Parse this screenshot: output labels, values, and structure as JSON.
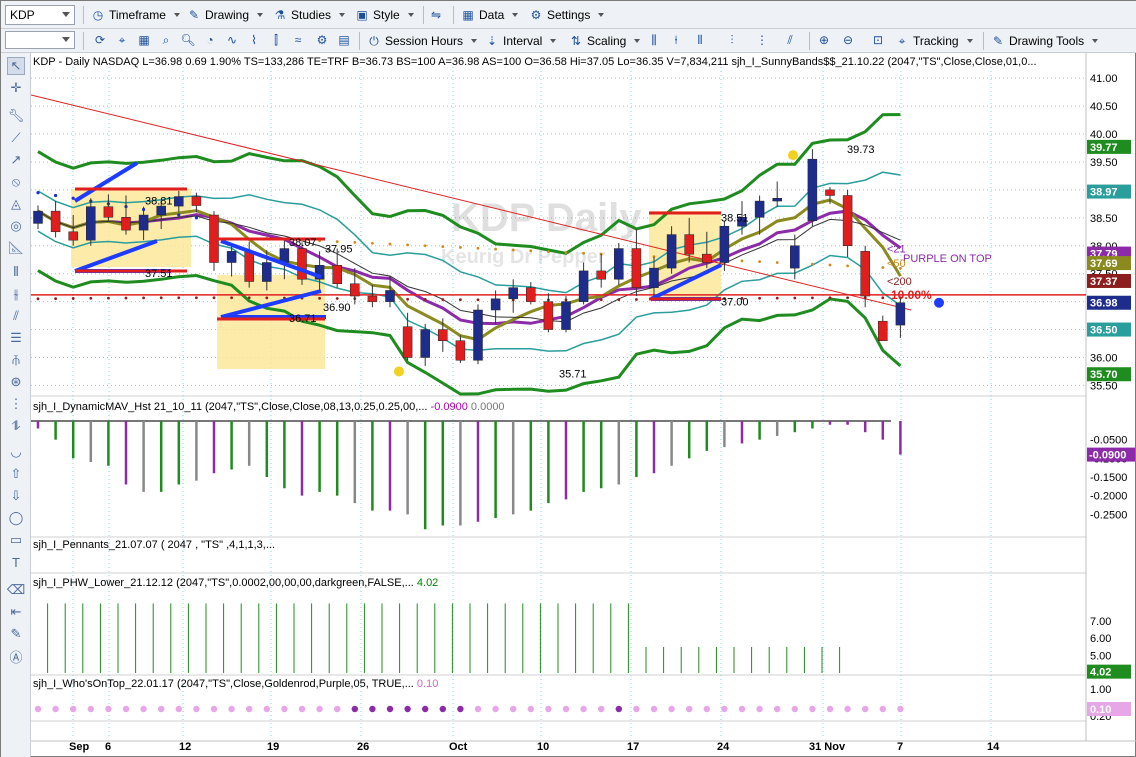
{
  "toolbar": {
    "symbol": "KDP",
    "timeframe": "Timeframe",
    "drawing": "Drawing",
    "studies": "Studies",
    "style": "Style",
    "data": "Data",
    "settings": "Settings",
    "session_hours": "Session Hours",
    "interval": "Interval",
    "scaling": "Scaling",
    "tracking": "Tracking",
    "drawing_tools": "Drawing Tools"
  },
  "header": {
    "line": "KDP - Daily  NASDAQ  L=36.98  0.69  1.90%  TS=133,286  TE=TRF  B=36.73  BS=100  A=36.98  AS=100  O=36.58  Hi=37.05  Lo=36.35  V=7,834,211  sjh_I_SunnyBands$$_21.10.22 (2047,\"TS\",Close,Close,01,0..."
  },
  "watermark": {
    "title": "KDP Daily",
    "subtitle": "Keurig Dr Pepper"
  },
  "price_labels": {
    "p3881": "38.81",
    "p3751": "37.51",
    "p3807": "38.07",
    "p3795": "37.95",
    "p3671": "36.71",
    "p3690": "36.90",
    "p3571": "35.71",
    "p3851": "38.51",
    "p3700": "37.00",
    "p3973": "39.73",
    "pct": "10.00%",
    "purple": "PURPLE ON TOP",
    "l21": "<21",
    "l50": "<50",
    "l200": "<200"
  },
  "axis": {
    "price_ticks": [
      "41.00",
      "40.50",
      "40.00",
      "39.50",
      "39.00",
      "38.50",
      "38.00",
      "37.50",
      "37.00",
      "36.50",
      "36.00",
      "35.50"
    ],
    "badges": [
      {
        "v": "39.77",
        "bg": "#1e8c1e",
        "fg": "#ffffff"
      },
      {
        "v": "38.97",
        "bg": "#2a9d9d",
        "fg": "#ffffff"
      },
      {
        "v": "37.79",
        "bg": "#8c2aa8",
        "fg": "#ffffff"
      },
      {
        "v": "37.69",
        "bg": "#8a8a1e",
        "fg": "#ffffff"
      },
      {
        "v": "37.37",
        "bg": "#8c1e1e",
        "fg": "#ffffff"
      },
      {
        "v": "36.98",
        "bg": "#1e2d8c",
        "fg": "#ffffff"
      },
      {
        "v": "36.50",
        "bg": "#2a9d9d",
        "fg": "#ffffff"
      },
      {
        "v": "35.70",
        "bg": "#1e8c1e",
        "fg": "#ffffff"
      }
    ],
    "dates": [
      "Sep",
      "6",
      "12",
      "19",
      "26",
      "Oct",
      "10",
      "17",
      "24",
      "31 Nov",
      "7",
      "14"
    ]
  },
  "panels": {
    "mav": {
      "label": "sjh_I_DynamicMAV_Hst 21_10_11 (2047,\"TS\",Close,Close,08,13,0.25,0.25,00,...",
      "v1": "-0.0900",
      "v2": "0.0000",
      "ticks": [
        "-0.0500",
        "-0.1000",
        "-0.1500",
        "-0.2000",
        "-0.2500"
      ],
      "badge": "-0.0900"
    },
    "pennants": {
      "label": "sjh_I_Pennants_21.07.07 ( 2047 , \"TS\" ,4,1,1,3,..."
    },
    "phw": {
      "label": "sjh_I_PHW_Lower_21.12.12 (2047,\"TS\",0.0002,00,00,00,darkgreen,FALSE,...",
      "value": "4.02",
      "ticks": [
        "7.00",
        "6.00",
        "5.00"
      ],
      "badge": "4.02"
    },
    "who": {
      "label": "sjh_I_Who'sOnTop_22.01.17 (2047,\"TS\",Close,Goldenrod,Purple,05, TRUE,...",
      "value": "0.10",
      "ticks": [
        "1.00",
        "0.20"
      ],
      "badge": "0.10"
    }
  },
  "chart_data": {
    "type": "candlestick",
    "ylim": [
      35.4,
      41.2
    ],
    "candles": [
      [
        38.4,
        38.72,
        38.3,
        38.62
      ],
      [
        38.62,
        38.8,
        38.15,
        38.25
      ],
      [
        38.25,
        38.55,
        38.0,
        38.1
      ],
      [
        38.1,
        38.85,
        38.0,
        38.7
      ],
      [
        38.7,
        38.92,
        38.45,
        38.51
      ],
      [
        38.51,
        38.9,
        38.2,
        38.28
      ],
      [
        38.28,
        38.7,
        38.1,
        38.55
      ],
      [
        38.55,
        38.81,
        38.3,
        38.71
      ],
      [
        38.71,
        38.98,
        38.6,
        38.88
      ],
      [
        38.88,
        38.95,
        38.6,
        38.72
      ],
      [
        38.55,
        38.62,
        37.55,
        37.7
      ],
      [
        37.7,
        38.0,
        37.45,
        37.9
      ],
      [
        37.9,
        38.07,
        37.25,
        37.36
      ],
      [
        37.36,
        37.92,
        37.2,
        37.7
      ],
      [
        37.7,
        38.1,
        37.4,
        37.95
      ],
      [
        37.95,
        38.06,
        37.3,
        37.4
      ],
      [
        37.4,
        37.9,
        37.15,
        37.65
      ],
      [
        37.65,
        37.95,
        37.25,
        37.32
      ],
      [
        37.32,
        37.6,
        36.95,
        37.1
      ],
      [
        37.1,
        37.3,
        36.9,
        37.0
      ],
      [
        37.0,
        37.45,
        36.9,
        37.2
      ],
      [
        36.55,
        36.8,
        35.95,
        36.0
      ],
      [
        36.0,
        36.6,
        35.85,
        36.5
      ],
      [
        36.5,
        36.7,
        36.1,
        36.3
      ],
      [
        36.3,
        36.4,
        35.9,
        35.95
      ],
      [
        35.95,
        36.95,
        35.88,
        36.85
      ],
      [
        36.85,
        37.2,
        36.6,
        37.05
      ],
      [
        37.05,
        37.4,
        36.8,
        37.25
      ],
      [
        37.25,
        37.35,
        36.95,
        37.0
      ],
      [
        37.0,
        37.15,
        36.45,
        36.5
      ],
      [
        36.5,
        37.1,
        36.45,
        37.0
      ],
      [
        37.0,
        37.7,
        36.95,
        37.55
      ],
      [
        37.55,
        37.85,
        37.25,
        37.4
      ],
      [
        37.4,
        38.05,
        37.3,
        37.95
      ],
      [
        37.95,
        38.3,
        37.1,
        37.25
      ],
      [
        37.25,
        37.8,
        37.1,
        37.6
      ],
      [
        37.6,
        38.35,
        37.5,
        38.2
      ],
      [
        38.2,
        38.5,
        37.7,
        37.85
      ],
      [
        37.85,
        38.25,
        37.6,
        37.7
      ],
      [
        37.7,
        38.45,
        37.55,
        38.35
      ],
      [
        38.35,
        38.8,
        38.2,
        38.51
      ],
      [
        38.51,
        38.9,
        38.2,
        38.8
      ],
      [
        38.8,
        39.15,
        38.7,
        38.85
      ],
      [
        37.6,
        38.2,
        37.4,
        38.0
      ],
      [
        38.45,
        39.73,
        38.35,
        39.55
      ],
      [
        39.0,
        39.05,
        38.75,
        38.9
      ],
      [
        38.9,
        39.0,
        37.8,
        38.0
      ],
      [
        37.9,
        38.0,
        36.9,
        37.1
      ],
      [
        36.65,
        36.75,
        36.3,
        36.3
      ],
      [
        36.58,
        37.05,
        36.35,
        36.98
      ]
    ],
    "histogram": [
      -0.02,
      -0.05,
      -0.1,
      -0.11,
      -0.12,
      -0.17,
      -0.19,
      -0.19,
      -0.17,
      -0.16,
      -0.14,
      -0.13,
      -0.12,
      -0.15,
      -0.18,
      -0.2,
      -0.19,
      -0.2,
      -0.22,
      -0.24,
      -0.24,
      -0.25,
      -0.29,
      -0.28,
      -0.28,
      -0.27,
      -0.26,
      -0.25,
      -0.24,
      -0.22,
      -0.21,
      -0.19,
      -0.18,
      -0.17,
      -0.15,
      -0.14,
      -0.12,
      -0.1,
      -0.08,
      -0.07,
      -0.06,
      -0.05,
      -0.04,
      -0.03,
      -0.02,
      -0.01,
      -0.01,
      -0.03,
      -0.05,
      -0.09
    ],
    "phw": [
      8,
      8,
      8,
      8,
      8,
      8,
      8,
      8,
      8,
      8,
      8,
      8,
      8,
      8,
      8,
      8,
      8,
      8,
      8,
      8,
      8,
      8,
      8,
      8,
      8,
      8,
      8,
      8,
      8,
      8,
      8,
      8,
      8,
      8,
      8,
      5.5,
      5.5,
      5.5,
      5.5,
      5.5,
      5.5,
      5.5,
      5.5,
      5.5,
      5.5,
      5.5,
      5.5,
      4.02,
      4.02,
      4.02
    ]
  }
}
